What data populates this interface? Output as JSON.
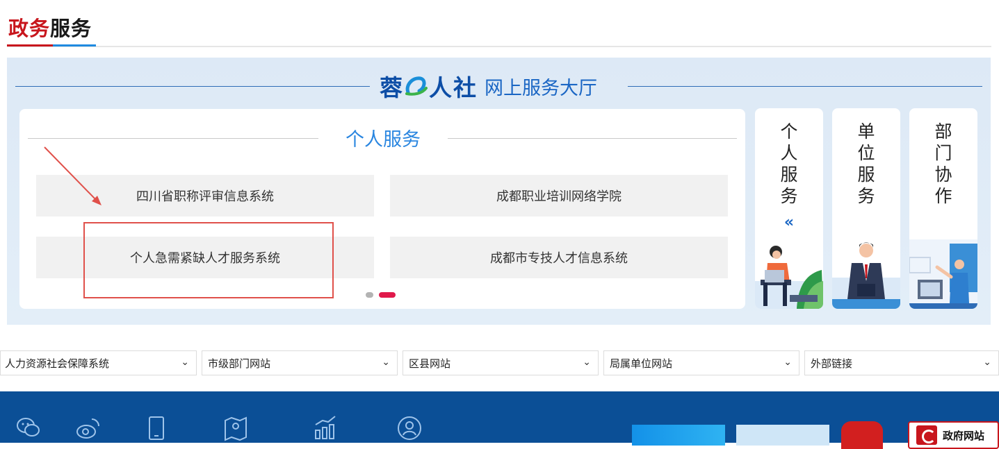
{
  "section": {
    "title_red": "政务",
    "title_dark": "服务"
  },
  "hall": {
    "logo_a": "蓉",
    "logo_b": "人社",
    "subtitle": "网上服务大厅"
  },
  "personal_card": {
    "title": "个人服务",
    "items": [
      "四川省职称评审信息系统",
      "成都职业培训网络学院",
      "个人急需紧缺人才服务系统",
      "成都市专技人才信息系统"
    ]
  },
  "tabs": [
    {
      "label": [
        "个",
        "人",
        "服",
        "务"
      ],
      "chevron": "«",
      "icon": "woman-laptop-icon"
    },
    {
      "label": [
        "单",
        "位",
        "服",
        "务"
      ],
      "icon": "businessman-icon"
    },
    {
      "label": [
        "部",
        "门",
        "协",
        "作"
      ],
      "icon": "presentation-man-icon"
    }
  ],
  "selects": [
    "人力资源社会保障系统",
    "市级部门网站",
    "区县网站",
    "局属单位网站",
    "外部链接"
  ],
  "footer": {
    "icons": [
      "wechat-icon",
      "weibo-icon",
      "mobile-icon",
      "map-icon",
      "chart-icon",
      "user-icon"
    ],
    "gov_badge_text": "政府网站"
  },
  "colors": {
    "accent_red": "#c8161d",
    "accent_blue": "#1f8ae0",
    "footer_bg": "#0b4f96",
    "dot_active": "#e0194b"
  }
}
